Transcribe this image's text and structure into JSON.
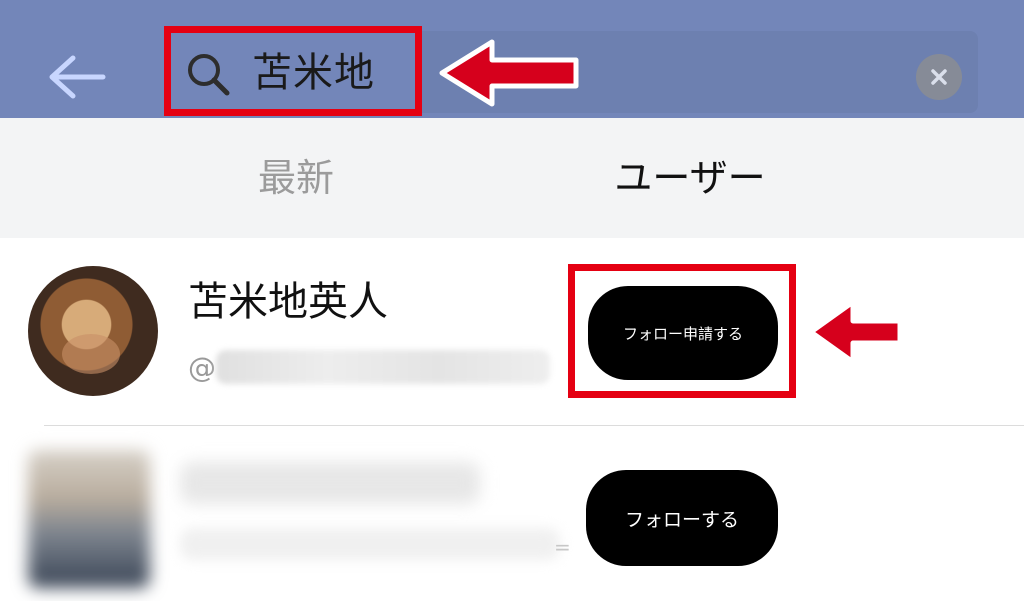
{
  "search": {
    "query": "苫米地"
  },
  "tabs": [
    {
      "label": "最新"
    },
    {
      "label": "ユーザー"
    }
  ],
  "results": [
    {
      "name": "苫米地英人",
      "handle_prefix": "@",
      "button_label": "フォロー申請する"
    },
    {
      "button_label": "フォローする",
      "trailing_mark": "="
    }
  ],
  "colors": {
    "header": "#7386b9",
    "search_field": "#6d80b0",
    "highlight_red": "#e50012",
    "button_black": "#000000",
    "tab_bar": "#f3f4f5"
  },
  "icons": [
    "back-arrow-icon",
    "search-icon",
    "clear-icon"
  ]
}
